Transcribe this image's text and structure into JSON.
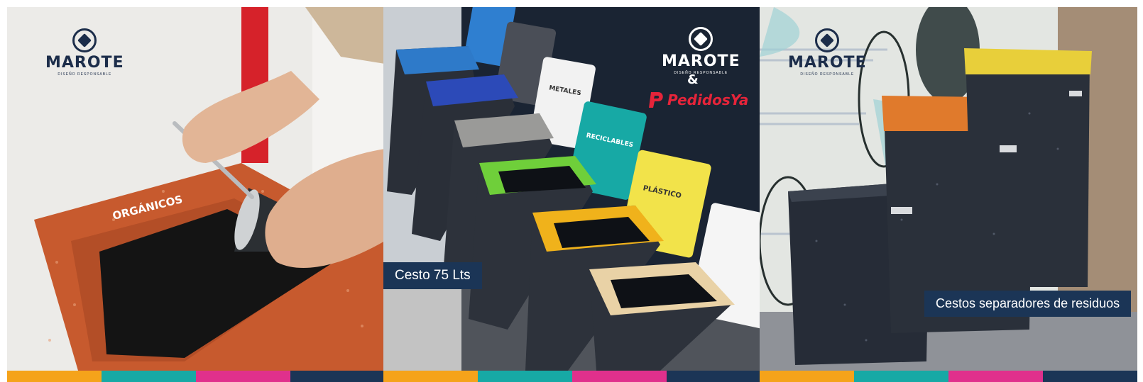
{
  "colors": {
    "bar": [
      "#f5a31a",
      "#17a9a5",
      "#e0308c",
      "#1b3556"
    ],
    "navy": "#1b3556",
    "brand_red": "#e6243a"
  },
  "panels": [
    {
      "logo": {
        "name": "MAROTE",
        "tagline": "DISEÑO RESPONSABLE"
      },
      "bin_label": "ORGÁNICOS"
    },
    {
      "logo": {
        "name": "MAROTE",
        "tagline": "DISEÑO RESPONSABLE"
      },
      "ampersand": "&",
      "partner": "PedidosYa",
      "caption": "Cesto 75 Lts",
      "signs": [
        "METALES",
        "RECICLABLES",
        "PLÁSTICO"
      ]
    },
    {
      "logo": {
        "name": "MAROTE",
        "tagline": "DISEÑO RESPONSABLE"
      },
      "caption": "Cestos separadores de residuos"
    }
  ]
}
